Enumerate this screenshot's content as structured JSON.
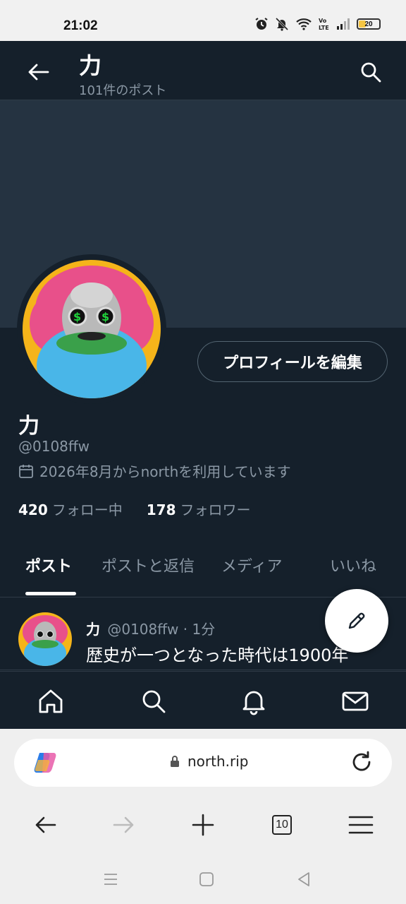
{
  "status_bar": {
    "time": "21:02",
    "battery": "20",
    "icons": [
      "alarm-icon",
      "mute-icon",
      "wifi-icon",
      "volte-icon",
      "signal-icon",
      "battery-icon"
    ]
  },
  "header": {
    "title": "力",
    "subtitle": "101件のポスト"
  },
  "profile": {
    "edit_label": "プロフィールを編集",
    "name": "力",
    "handle": "@0108ffw",
    "joined": "2026年8月からnorthを利用しています",
    "following_count": "420",
    "following_label": "フォロー中",
    "followers_count": "178",
    "followers_label": "フォロワー"
  },
  "tabs": [
    {
      "label": "ポスト",
      "active": true
    },
    {
      "label": "ポストと返信",
      "active": false
    },
    {
      "label": "メディア",
      "active": false
    },
    {
      "label": "いいね",
      "active": false
    }
  ],
  "post": {
    "name": "力",
    "handle": "@0108ffw",
    "time": "· 1分",
    "text": "歴史が一つとなった時代は1900年"
  },
  "browser": {
    "url": "north.rip",
    "tab_count": "10"
  },
  "colors": {
    "background": "#15202b",
    "banner": "#253341",
    "muted_text": "#8b98a5"
  }
}
